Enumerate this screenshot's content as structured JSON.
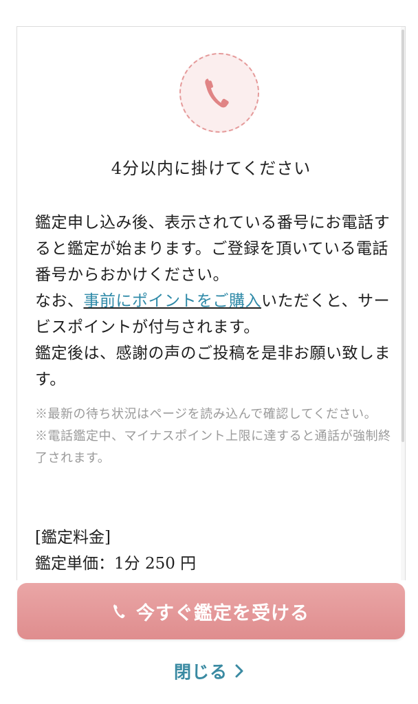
{
  "modal": {
    "title": "4分以内に掛けてください",
    "body": {
      "p1": "鑑定申し込み後、表示されている番号にお電話すると鑑定が始まります。ご登録を頂いている電話番号からおかけください。",
      "p2_before": "なお、",
      "p2_link": "事前にポイントをご購入",
      "p2_after": "いただくと、サービスポイントが付与されます。",
      "p3": "鑑定後は、感謝の声のご投稿を是非お願い致します。"
    },
    "notes": [
      "※最新の待ち状況はページを読み込んで確認してください。",
      "※電話鑑定中、マイナスポイント上限に達すると通話が強制終了されます。"
    ],
    "fee": {
      "heading": "[鑑定料金]",
      "unit_price": "鑑定単価：1分 250 円"
    }
  },
  "actions": {
    "primary_label": "今すぐ鑑定を受ける",
    "close_label": "閉じる"
  },
  "icons": {
    "header": "phone-icon",
    "primary": "phone-icon",
    "close": "chevron-right-icon"
  },
  "colors": {
    "accent_pink": "#e08f90",
    "link_teal": "#2f8aa8",
    "close_teal": "#3a8aa2"
  }
}
